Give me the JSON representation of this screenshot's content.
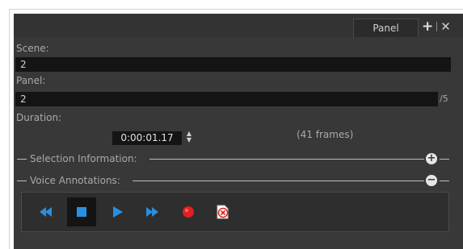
{
  "tab": {
    "label": "Panel"
  },
  "scene": {
    "label": "Scene:",
    "value": "2"
  },
  "panel": {
    "label": "Panel:",
    "value": "2",
    "suffix": "/5"
  },
  "duration": {
    "label": "Duration:",
    "value": "0:00:01.17",
    "frames_text": "(41 frames)"
  },
  "sections": {
    "selection_info": {
      "label": "Selection Information:",
      "state": "collapsed",
      "icon": "plus-circle-icon"
    },
    "voice_annotations": {
      "label": "Voice Annotations:",
      "state": "expanded",
      "icon": "minus-circle-icon"
    }
  },
  "toolbar": {
    "buttons": [
      {
        "name": "rewind",
        "icon": "rewind-icon"
      },
      {
        "name": "stop",
        "icon": "stop-icon",
        "active": true
      },
      {
        "name": "play",
        "icon": "play-icon"
      },
      {
        "name": "fast-forward",
        "icon": "fast-forward-icon"
      },
      {
        "name": "record",
        "icon": "record-icon"
      },
      {
        "name": "delete-annotation",
        "icon": "delete-annotation-icon"
      }
    ]
  },
  "colors": {
    "panel_bg": "#383838",
    "field_bg": "#141414",
    "accent_blue": "#2a8fe0",
    "record_red": "#e02020"
  }
}
